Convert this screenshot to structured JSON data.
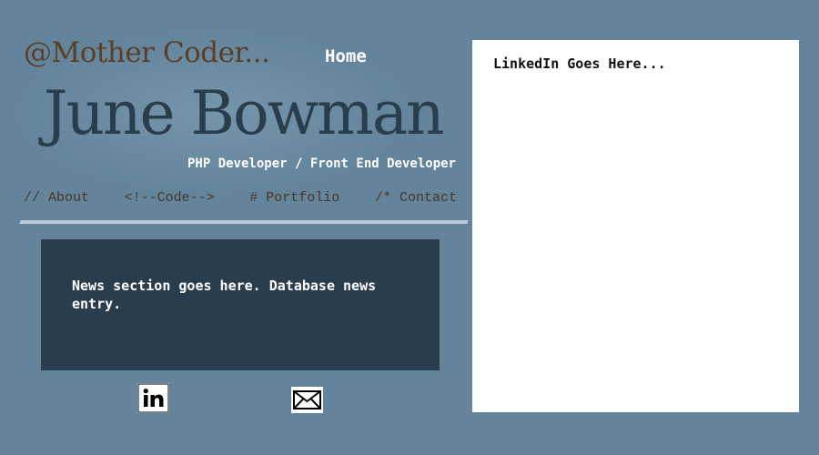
{
  "header": {
    "brand": "@Mother Coder...",
    "home_label": "Home",
    "name": "June Bowman",
    "role": "PHP Developer / Front End Developer"
  },
  "nav": {
    "items": [
      {
        "label": "// About"
      },
      {
        "label": "<!--Code-->"
      },
      {
        "label": "# Portfolio"
      },
      {
        "label": "/* Contact"
      }
    ]
  },
  "news": {
    "text": "News section goes here. Database news entry."
  },
  "social": {
    "linkedin_icon": "linkedin-icon",
    "mail_icon": "envelope-icon"
  },
  "linkedin_panel": {
    "text": "LinkedIn Goes Here..."
  },
  "colors": {
    "background": "#63849b",
    "brand_text": "#5a3e28",
    "name_text": "#2a3d4c",
    "news_background": "#2a3d4c",
    "divider": "#b9c8d2"
  }
}
